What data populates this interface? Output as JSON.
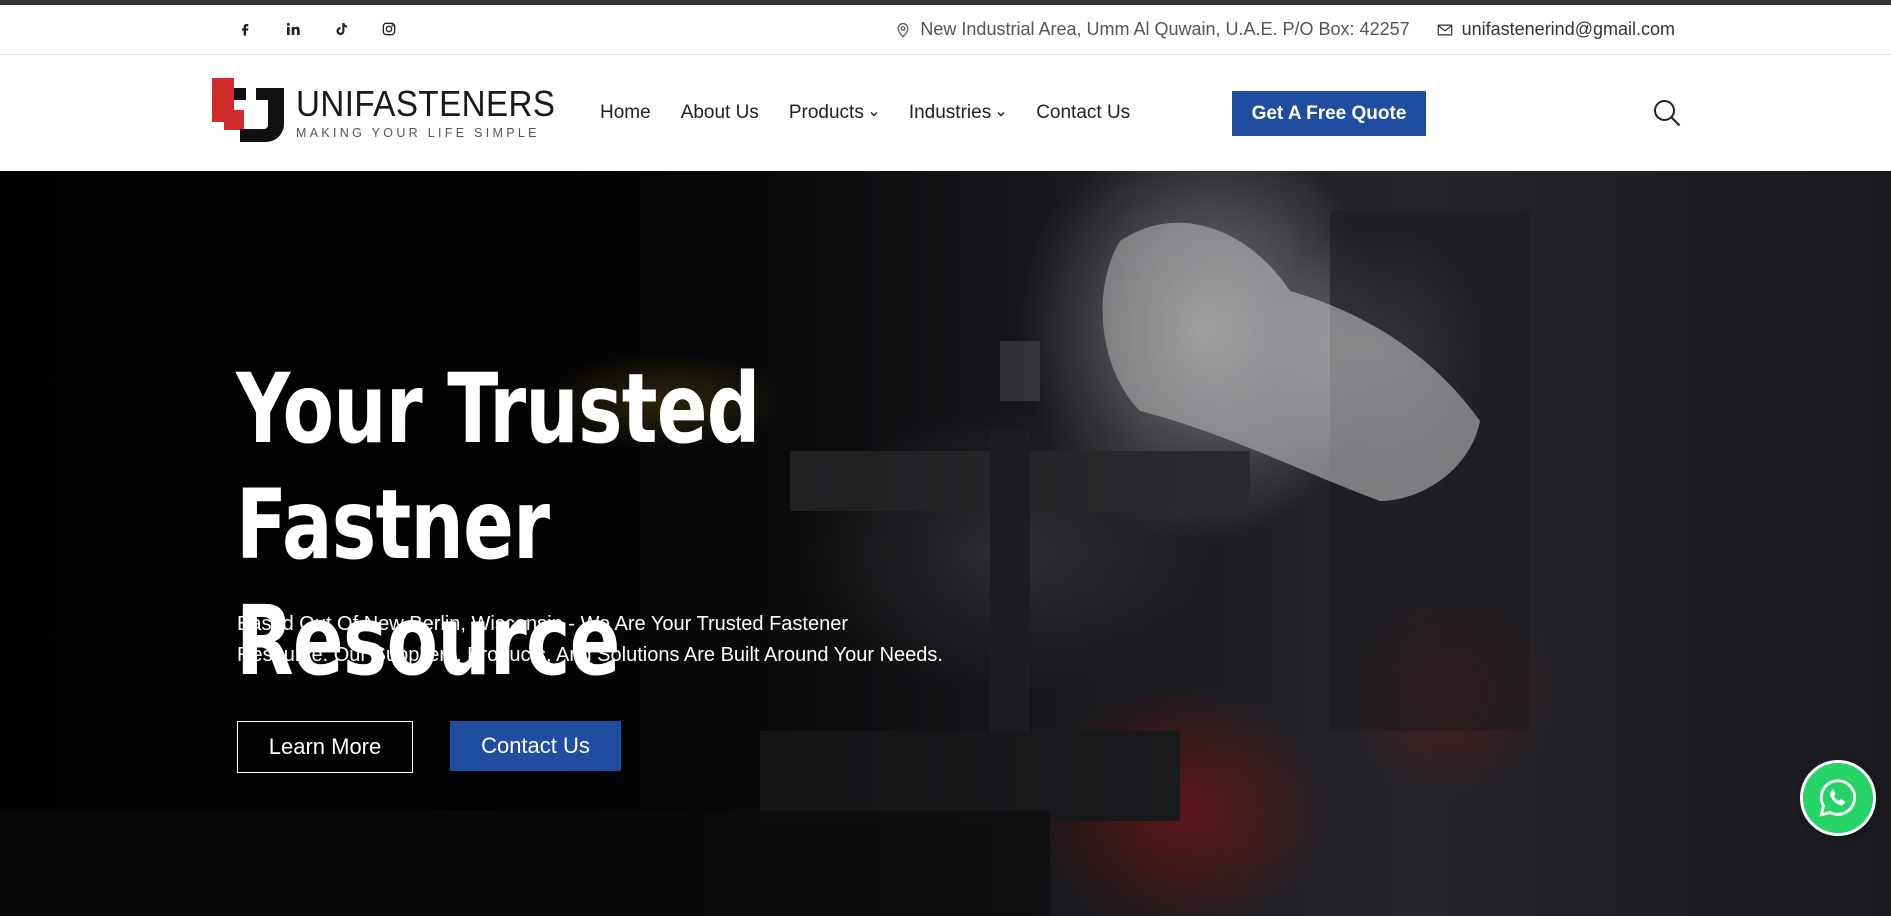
{
  "colors": {
    "primary": "#1f4ea1",
    "logo_red": "#d22b2b",
    "whatsapp": "#25d366"
  },
  "topbar": {
    "socials": [
      {
        "icon": "facebook-icon"
      },
      {
        "icon": "linkedin-icon"
      },
      {
        "icon": "tiktok-icon"
      },
      {
        "icon": "instagram-icon"
      }
    ],
    "address": "New Industrial Area, Umm Al Quwain, U.A.E. P/O Box: 42257",
    "email": "unifastenerind@gmail.com"
  },
  "header": {
    "logo": {
      "name": "UNIFASTENERS",
      "tagline": "MAKING YOUR LIFE SIMPLE"
    },
    "nav": [
      {
        "label": "Home",
        "has_dropdown": false
      },
      {
        "label": "About Us",
        "has_dropdown": false
      },
      {
        "label": "Products",
        "has_dropdown": true
      },
      {
        "label": "Industries",
        "has_dropdown": true
      },
      {
        "label": "Contact Us",
        "has_dropdown": false
      }
    ],
    "cta": "Get A Free Quote",
    "search_icon": "search-icon"
  },
  "hero": {
    "title_line1": "Your Trusted",
    "title_line2": "Fastner Resource",
    "subtitle_line1": "Based Out Of New Berlin, Wisconsin - We Are Your Trusted Fastener",
    "subtitle_line2": "Resource. Our Suppliers, Products, And Solutions Are Built Around Your Needs.",
    "learn_more": "Learn More",
    "contact_us": "Contact Us"
  },
  "floating": {
    "whatsapp_icon": "whatsapp-icon"
  }
}
